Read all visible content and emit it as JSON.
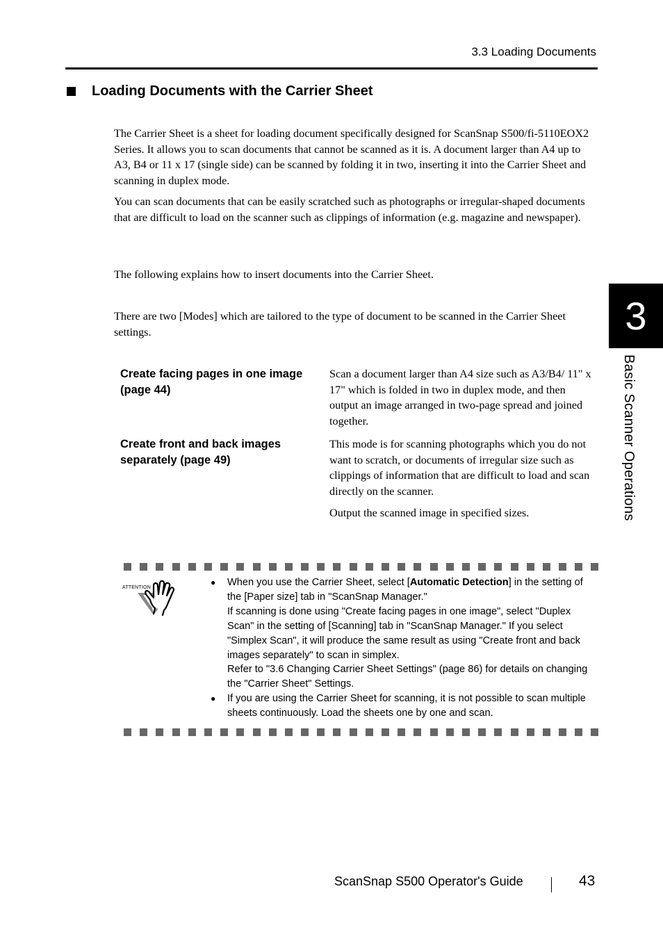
{
  "header": {
    "running_head": "3.3 Loading Documents"
  },
  "section": {
    "bullet_icon": "black-square",
    "title": "Loading Documents with the Carrier Sheet"
  },
  "body": {
    "paragraphs": [
      "The Carrier Sheet is a sheet for loading document specifically designed for ScanSnap S500/fi-5110EOX2 Series. It allows you to scan documents that cannot be scanned as it is. A document larger than A4 up to A3, B4 or 11 x 17 (single side) can be scanned by folding it in two, inserting it into the Carrier Sheet and scanning in duplex mode.",
      "You can scan documents that can be easily scratched such as photographs or irregular-shaped documents that are difficult to load on the scanner such as clippings of information (e.g. magazine and newspaper).",
      "The following explains how to insert documents into the Carrier Sheet.",
      "There are two [Modes] which are tailored to the type of document to be scanned in the Carrier Sheet settings."
    ]
  },
  "modes": [
    {
      "name": "Create facing pages in one image (page 44)",
      "description": [
        "Scan a document larger than A4 size such as A3/B4/ 11\" x 17\" which is folded in two in duplex mode, and then output an image arranged in two-page spread and joined together."
      ]
    },
    {
      "name": "Create front and back images separately (page 49)",
      "description": [
        "This mode is for scanning photographs which you do not want to scratch, or documents of irregular size such as clippings of information that are difficult to load and scan directly on the scanner.",
        "Output the scanned image in specified sizes."
      ]
    }
  ],
  "attention": {
    "icon": "attention-hand-icon",
    "label": "ATTENTION",
    "notes": [
      {
        "pre": "When you use the Carrier Sheet, select [",
        "bold": "Automatic Detection",
        "post": "] in the setting of the [Paper size] tab in \"ScanSnap Manager.\"",
        "extra": [
          "If scanning is done using \"Create facing pages in one image\", select \"Duplex Scan\" in the setting of [Scanning] tab in \"ScanSnap Manager.\" If you select \"Simplex Scan\", it will produce the same result as using \"Create front and back images separately\" to scan in simplex.",
          "Refer to \"3.6 Changing Carrier Sheet Settings\" (page 86) for details on changing the \"Carrier Sheet\" Settings."
        ]
      },
      {
        "text": "If you are using the Carrier Sheet for scanning, it is not possible to scan multiple sheets continuously. Load the sheets one by one and scan."
      }
    ]
  },
  "side_tab": {
    "chapter_number": "3",
    "chapter_title": "Basic Scanner Operations"
  },
  "footer": {
    "guide_title": "ScanSnap  S500 Operator's Guide",
    "page_number": "43"
  }
}
